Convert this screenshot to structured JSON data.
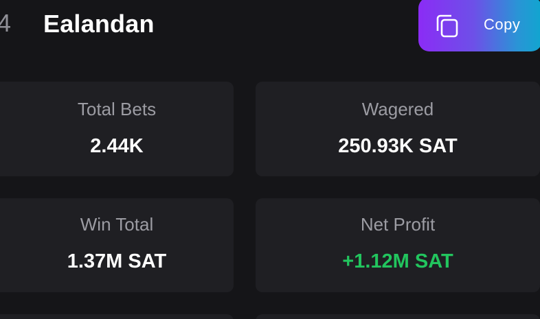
{
  "header": {
    "level_fragment": "4",
    "username": "Ealandan",
    "copy_label": "Copy",
    "copy_icon": "copy-icon",
    "copy_gradient": [
      "#8b2cf5",
      "#10a6cf"
    ]
  },
  "stats": [
    {
      "label": "Total Bets",
      "value": "2.44K"
    },
    {
      "label": "Wagered",
      "value": "250.93K SAT"
    },
    {
      "label": "Win Total",
      "value": "1.37M SAT"
    },
    {
      "label": "Net Profit",
      "value": "+1.12M SAT",
      "value_color": "#22c55e"
    }
  ],
  "colors": {
    "background": "#151518",
    "card": "#1f1f23",
    "label": "#9c9ca3",
    "positive": "#22c55e"
  }
}
